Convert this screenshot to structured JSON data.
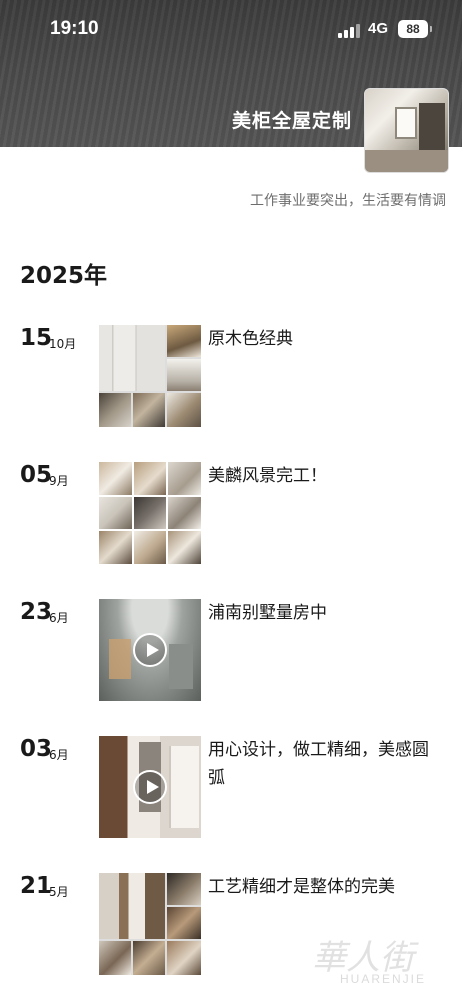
{
  "status_bar": {
    "time": "19:10",
    "network": "4G",
    "battery": "88"
  },
  "profile": {
    "name": "美柜全屋定制",
    "signature": "工作事业要突出，生活要有情调",
    "avatar_icon": "interior-room-photo"
  },
  "year_header": "2025年",
  "posts": [
    {
      "day": "15",
      "month": "10月",
      "text": "原木色经典",
      "media": "photo-grid",
      "icon": "wardrobe-photos"
    },
    {
      "day": "05",
      "month": "9月",
      "text": "美麟风景完工！",
      "media": "photo-grid",
      "icon": "interior-photos"
    },
    {
      "day": "23",
      "month": "6月",
      "text": "浦南别墅量房中",
      "media": "video",
      "icon": "play-icon"
    },
    {
      "day": "03",
      "month": "6月",
      "text": "用心设计，做工精细，美感圆弧",
      "media": "video",
      "icon": "play-icon"
    },
    {
      "day": "21",
      "month": "5月",
      "text": "工艺精细才是整体的完美",
      "media": "photo-grid",
      "icon": "cabinet-photos"
    }
  ],
  "watermark": {
    "chinese": "華人街",
    "english": "HUARENJIE"
  },
  "colors": {
    "cover_bg": "#454545",
    "text": "#1a1a1a",
    "signature": "#6d6d6d"
  }
}
